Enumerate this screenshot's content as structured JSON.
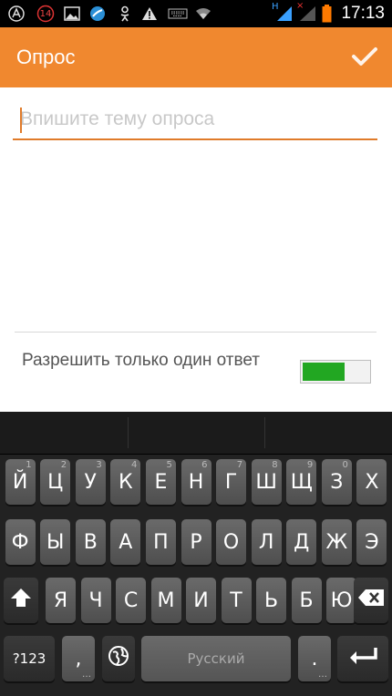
{
  "status_bar": {
    "notification_count": "14",
    "network_type": "H",
    "time": "17:13"
  },
  "app_bar": {
    "title": "Опрос",
    "confirm_icon": "check-icon"
  },
  "form": {
    "topic_placeholder": "Впишите тему опроса",
    "topic_value": "",
    "single_answer_label": "Разрешить только один ответ",
    "single_answer_enabled": true
  },
  "keyboard": {
    "row1": [
      {
        "label": "Й",
        "hint": "1"
      },
      {
        "label": "Ц",
        "hint": "2"
      },
      {
        "label": "У",
        "hint": "3"
      },
      {
        "label": "К",
        "hint": "4"
      },
      {
        "label": "Е",
        "hint": "5"
      },
      {
        "label": "Н",
        "hint": "6"
      },
      {
        "label": "Г",
        "hint": "7"
      },
      {
        "label": "Ш",
        "hint": "8"
      },
      {
        "label": "Щ",
        "hint": "9"
      },
      {
        "label": "З",
        "hint": "0"
      },
      {
        "label": "Х",
        "hint": ""
      }
    ],
    "row2": [
      "Ф",
      "Ы",
      "В",
      "А",
      "П",
      "Р",
      "О",
      "Л",
      "Д",
      "Ж",
      "Э"
    ],
    "row3": [
      "Я",
      "Ч",
      "С",
      "М",
      "И",
      "Т",
      "Ь",
      "Б",
      "Ю"
    ],
    "symbols_label": "?123",
    "comma_label": ",",
    "space_label": "Русский",
    "period_label": ".",
    "colors": {
      "accent": "#f0882f",
      "toggle_on": "#22a722"
    }
  }
}
